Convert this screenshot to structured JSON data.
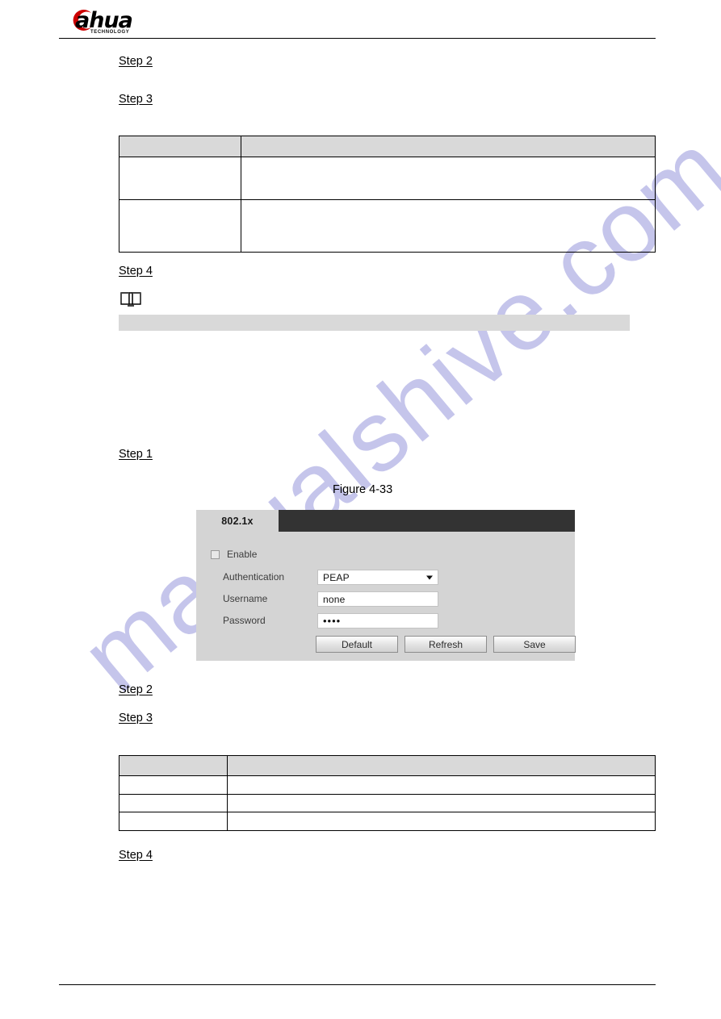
{
  "header": {
    "logo_word": "ahua",
    "logo_tagline": "TECHNOLOGY",
    "brand_red": "#cc0000"
  },
  "watermark": {
    "text": "manualshive.com",
    "color": "#bcbce8"
  },
  "steps": {
    "step2_top": "Step 2",
    "step3_top": "Step 3",
    "step4_top": "Step 4",
    "step1_mid": "Step 1",
    "step2_bottom": "Step 2",
    "step3_bottom": "Step 3",
    "step4_bottom": "Step 4"
  },
  "table_top": {
    "header": [
      "",
      ""
    ],
    "rows": [
      [
        "",
        ""
      ],
      [
        "",
        ""
      ]
    ]
  },
  "table_bottom": {
    "header": [
      "",
      ""
    ],
    "rows": [
      [
        "",
        ""
      ],
      [
        "",
        ""
      ],
      [
        "",
        ""
      ]
    ]
  },
  "note": {
    "icon": "open-book-icon",
    "body": ""
  },
  "figure": {
    "caption": "Figure 4-33"
  },
  "dialog": {
    "tab_label": "802.1x",
    "enable_label": "Enable",
    "enable_checked": false,
    "fields": [
      {
        "label": "Authentication",
        "type": "select",
        "value": "PEAP"
      },
      {
        "label": "Username",
        "type": "text",
        "value": "none"
      },
      {
        "label": "Password",
        "type": "password",
        "value": "••••"
      }
    ],
    "buttons": [
      {
        "label": "Default"
      },
      {
        "label": "Refresh"
      },
      {
        "label": "Save"
      }
    ]
  }
}
